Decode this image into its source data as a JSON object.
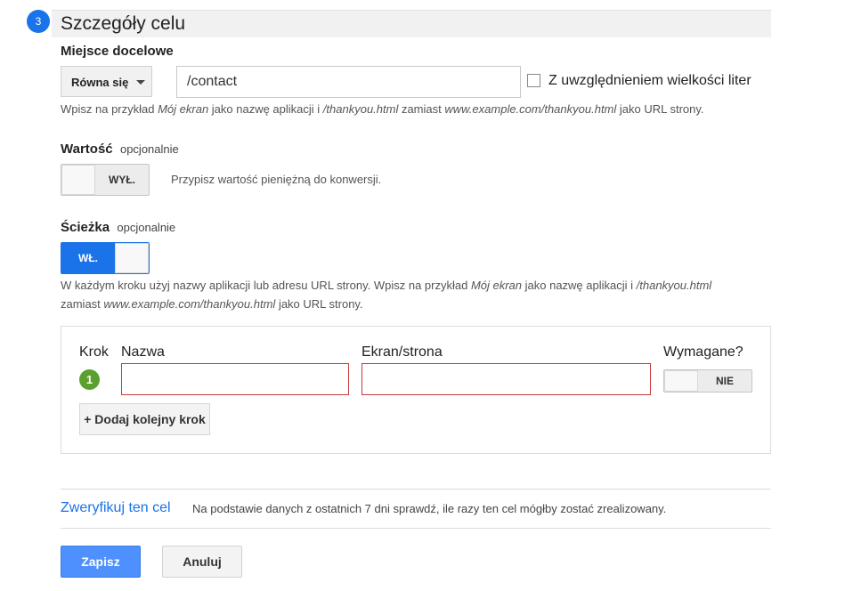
{
  "section": {
    "number": "3",
    "title": "Szczegóły celu"
  },
  "destination": {
    "label": "Miejsce docelowe",
    "match_type": "Równa się",
    "value": "/contact",
    "case_sensitive_label": "Z uwzględnieniem wielkości liter",
    "hint": {
      "p1": "Wpisz na przykład ",
      "i1": "Mój ekran",
      "p2": " jako nazwę aplikacji i ",
      "i2": "/thankyou.html",
      "p3": " zamiast ",
      "i3": "www.example.com/thankyou.html",
      "p4": " jako URL strony."
    }
  },
  "value_field": {
    "label": "Wartość",
    "optional": "opcjonalnie",
    "toggle": "WYŁ.",
    "hint": "Przypisz wartość pieniężną do konwersji."
  },
  "funnel": {
    "label": "Ścieżka",
    "optional": "opcjonalnie",
    "toggle": "WŁ.",
    "hint": {
      "p1": "W każdym kroku użyj nazwy aplikacji lub adresu URL strony. Wpisz na przykład ",
      "i1": "Mój ekran",
      "p2": " jako nazwę aplikacji i ",
      "i2": "/thankyou.html",
      "p3": "zamiast ",
      "i3": "www.example.com/thankyou.html",
      "p4": " jako URL strony."
    },
    "columns": {
      "step": "Krok",
      "name": "Nazwa",
      "screen": "Ekran/strona",
      "required": "Wymagane?"
    },
    "steps": [
      {
        "number": "1",
        "name": "",
        "screen": "",
        "required": "NIE"
      }
    ],
    "add_step": "+ Dodaj kolejny krok"
  },
  "verify": {
    "link": "Zweryfikuj ten cel",
    "hint": "Na podstawie danych z ostatnich 7 dni sprawdź, ile razy ten cel mógłby zostać zrealizowany."
  },
  "actions": {
    "save": "Zapisz",
    "cancel": "Anuluj"
  },
  "colors": {
    "accent": "#1a73e8",
    "step_badge": "#5aa02c",
    "error_border": "#c53b3b",
    "save_button": "#4d90fe"
  }
}
